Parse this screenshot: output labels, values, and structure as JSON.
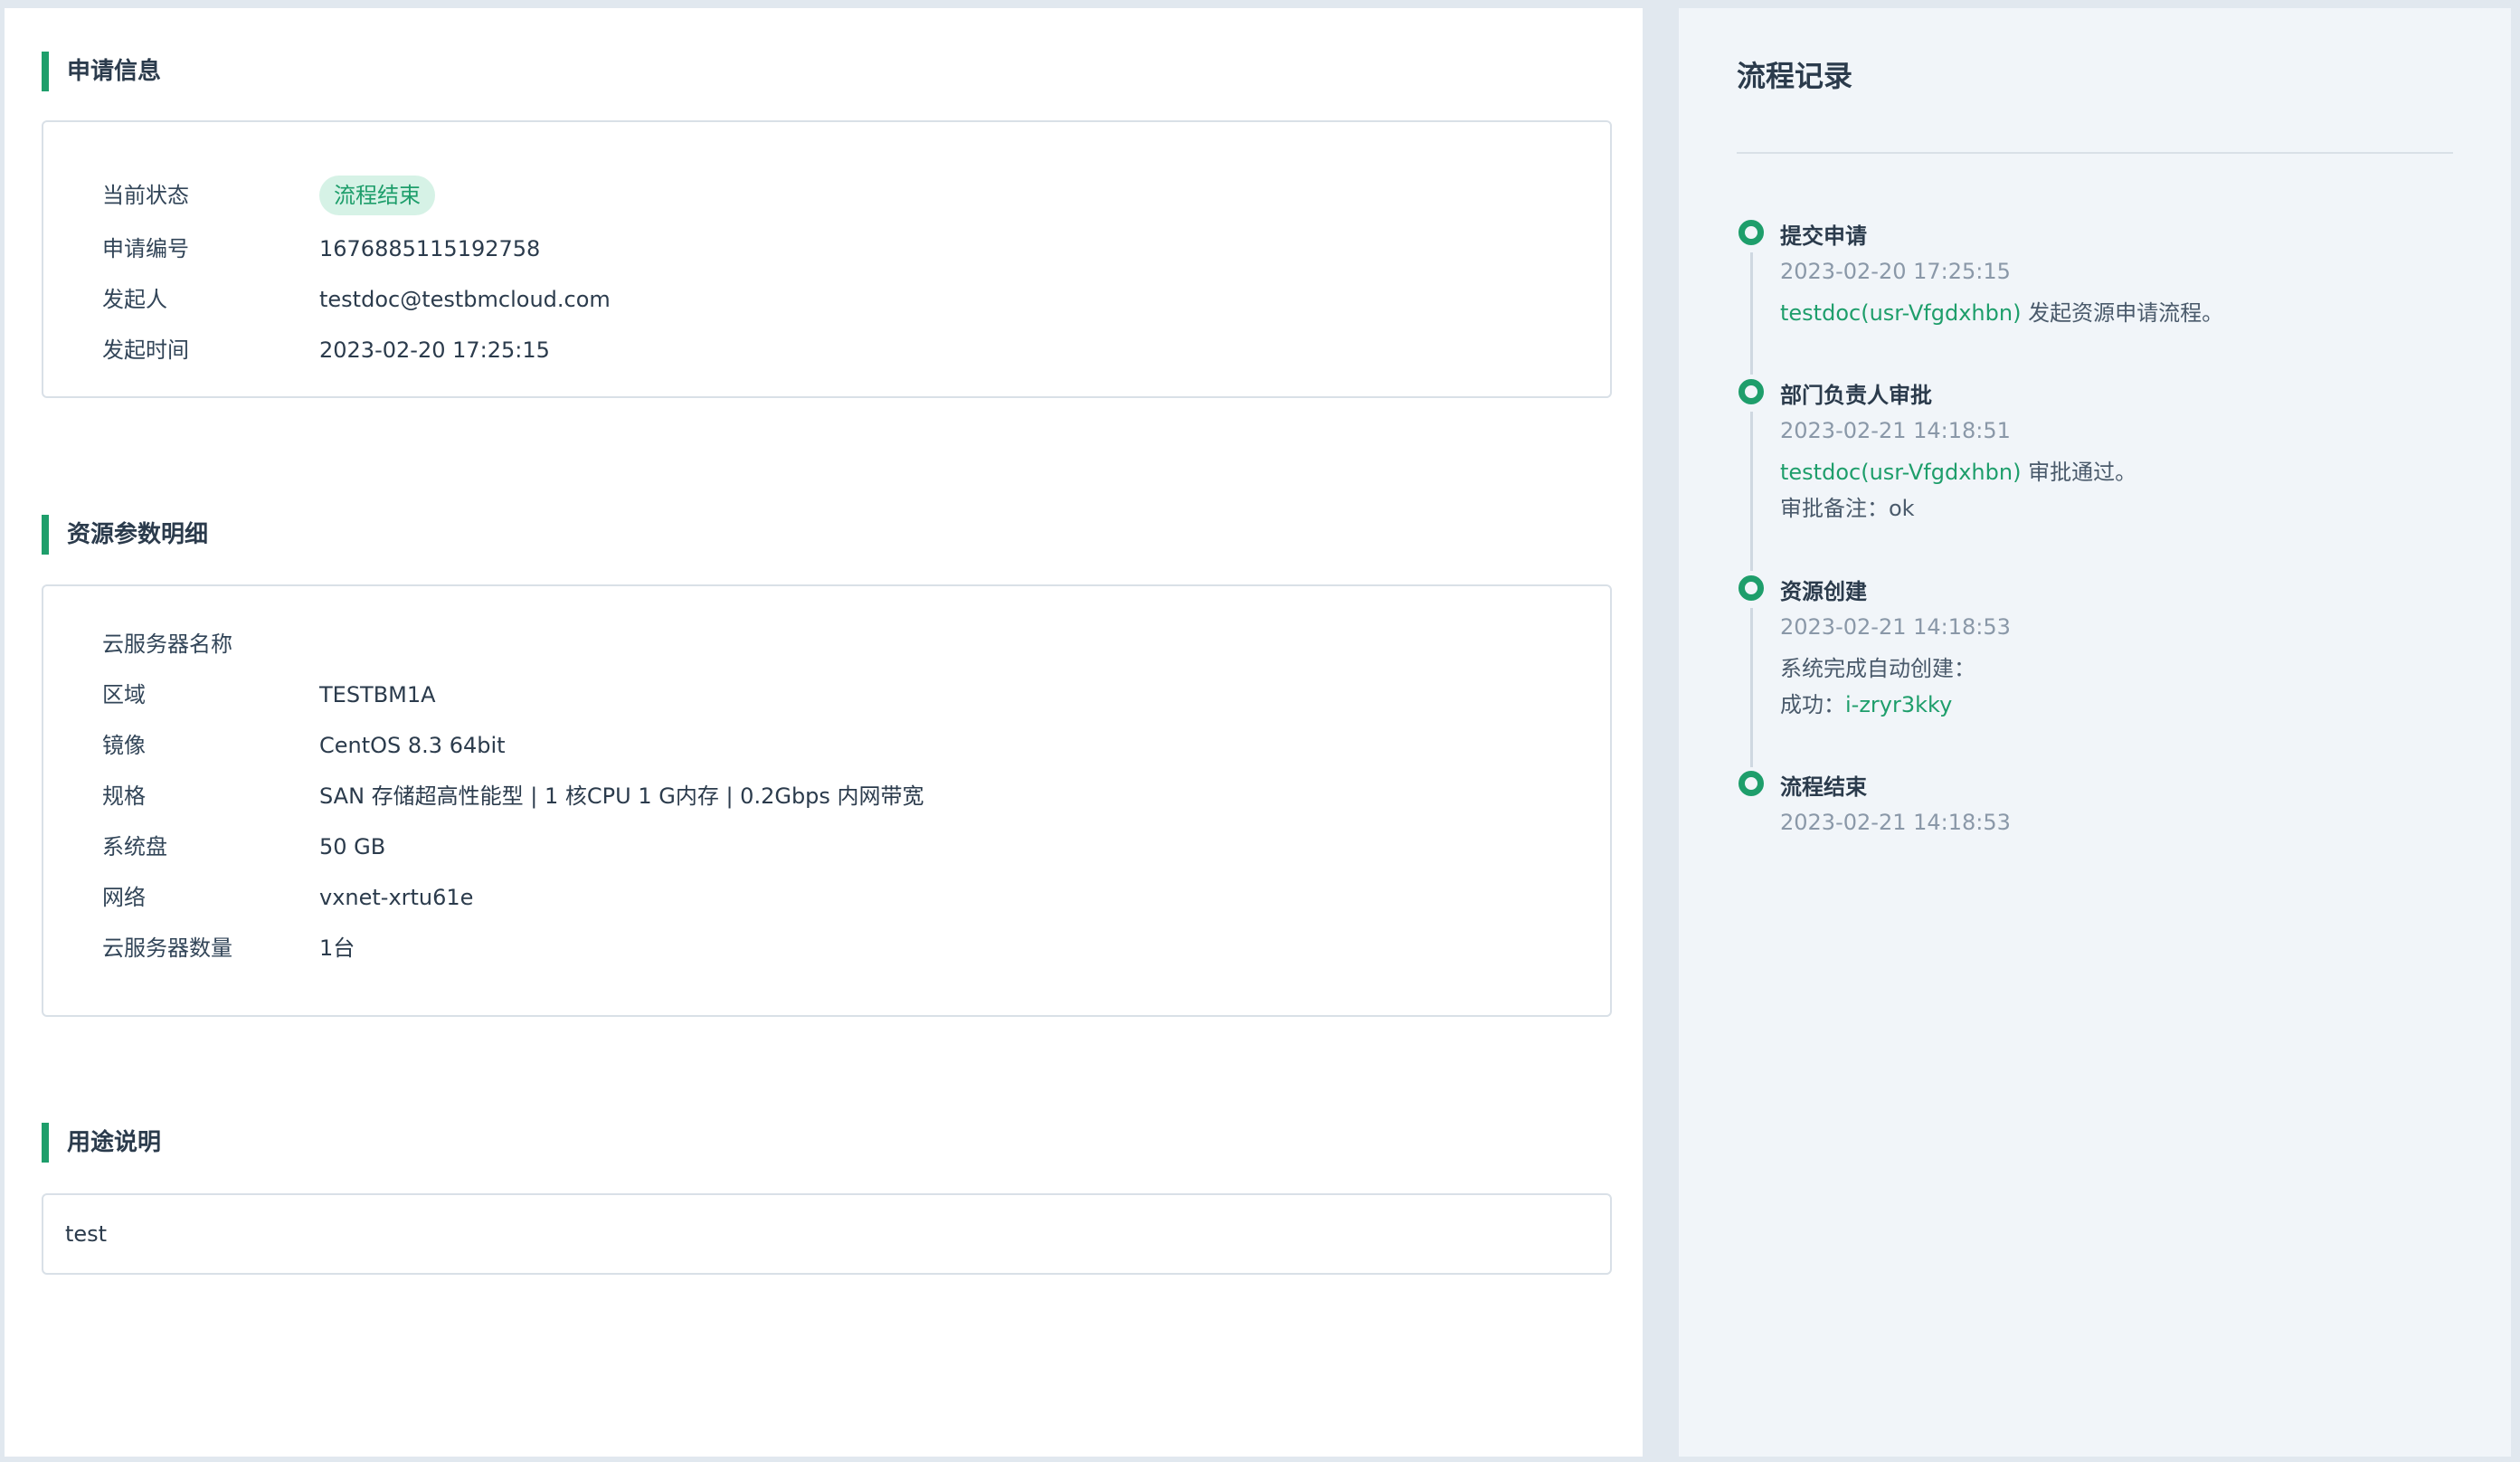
{
  "application_info": {
    "title": "申请信息",
    "rows": [
      {
        "label": "当前状态",
        "value": "流程结束"
      },
      {
        "label": "申请编号",
        "value": "1676885115192758"
      },
      {
        "label": "发起人",
        "value": "testdoc@testbmcloud.com"
      },
      {
        "label": "发起时间",
        "value": "2023-02-20 17:25:15"
      }
    ]
  },
  "resource_params": {
    "title": "资源参数明细",
    "rows": [
      {
        "label": "云服务器名称",
        "value": ""
      },
      {
        "label": "区域",
        "value": "TESTBM1A"
      },
      {
        "label": "镜像",
        "value": "CentOS 8.3 64bit"
      },
      {
        "label": "规格",
        "value": "SAN 存储超高性能型 | 1 核CPU 1 G内存 | 0.2Gbps 内网带宽"
      },
      {
        "label": "系统盘",
        "value": "50 GB"
      },
      {
        "label": "网络",
        "value": "vxnet-xrtu61e"
      },
      {
        "label": "云服务器数量",
        "value": "1台"
      }
    ]
  },
  "purpose": {
    "title": "用途说明",
    "text": "test"
  },
  "flow_record": {
    "title": "流程记录",
    "steps": [
      {
        "title": "提交申请",
        "time": "2023-02-20 17:25:15",
        "user": "testdoc(usr-Vfgdxhbn)",
        "action": " 发起资源申请流程。"
      },
      {
        "title": "部门负责人审批",
        "time": "2023-02-21 14:18:51",
        "user": "testdoc(usr-Vfgdxhbn)",
        "action": " 审批通过。",
        "note": "审批备注：ok"
      },
      {
        "title": "资源创建",
        "time": "2023-02-21 14:18:53",
        "desc": "系统完成自动创建：",
        "result_label": "成功：",
        "result_value": "i-zryr3kky"
      },
      {
        "title": "流程结束",
        "time": "2023-02-21 14:18:53"
      }
    ]
  },
  "colors": {
    "accent": "#1e9e6b",
    "badge_bg": "#d6f2e6",
    "page_bg": "#e1e8ef",
    "right_panel_bg": "#f1f5f9"
  }
}
